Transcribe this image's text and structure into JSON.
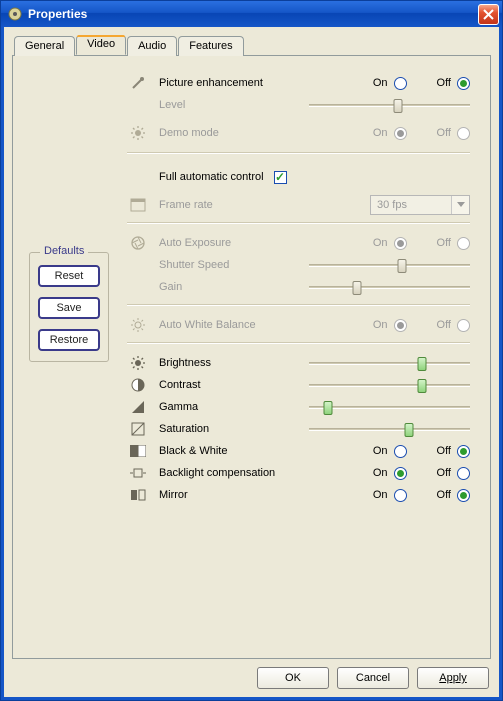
{
  "window": {
    "title": "Properties"
  },
  "tabs": {
    "general": "General",
    "video": "Video",
    "audio": "Audio",
    "features": "Features"
  },
  "defaults": {
    "legend": "Defaults",
    "reset": "Reset",
    "save": "Save",
    "restore": "Restore"
  },
  "labels": {
    "on": "On",
    "off": "Off",
    "picture_enhancement": "Picture enhancement",
    "level": "Level",
    "demo_mode": "Demo mode",
    "full_auto": "Full automatic control",
    "frame_rate": "Frame rate",
    "auto_exposure": "Auto Exposure",
    "shutter_speed": "Shutter Speed",
    "gain": "Gain",
    "auto_wb": "Auto White Balance",
    "brightness": "Brightness",
    "contrast": "Contrast",
    "gamma": "Gamma",
    "saturation": "Saturation",
    "bw": "Black & White",
    "backlight": "Backlight compensation",
    "mirror": "Mirror"
  },
  "values": {
    "frame_rate": "30 fps",
    "full_auto_checked": true,
    "picture_enhancement": "off",
    "demo_mode": "on",
    "auto_exposure": "on",
    "auto_wb": "on",
    "bw": "off",
    "backlight": "on",
    "mirror": "off",
    "sliders": {
      "level": 0.55,
      "shutter_speed": 0.58,
      "gain": 0.3,
      "brightness": 0.7,
      "contrast": 0.7,
      "gamma": 0.12,
      "saturation": 0.62
    }
  },
  "buttons": {
    "ok": "OK",
    "cancel": "Cancel",
    "apply": "Apply"
  }
}
